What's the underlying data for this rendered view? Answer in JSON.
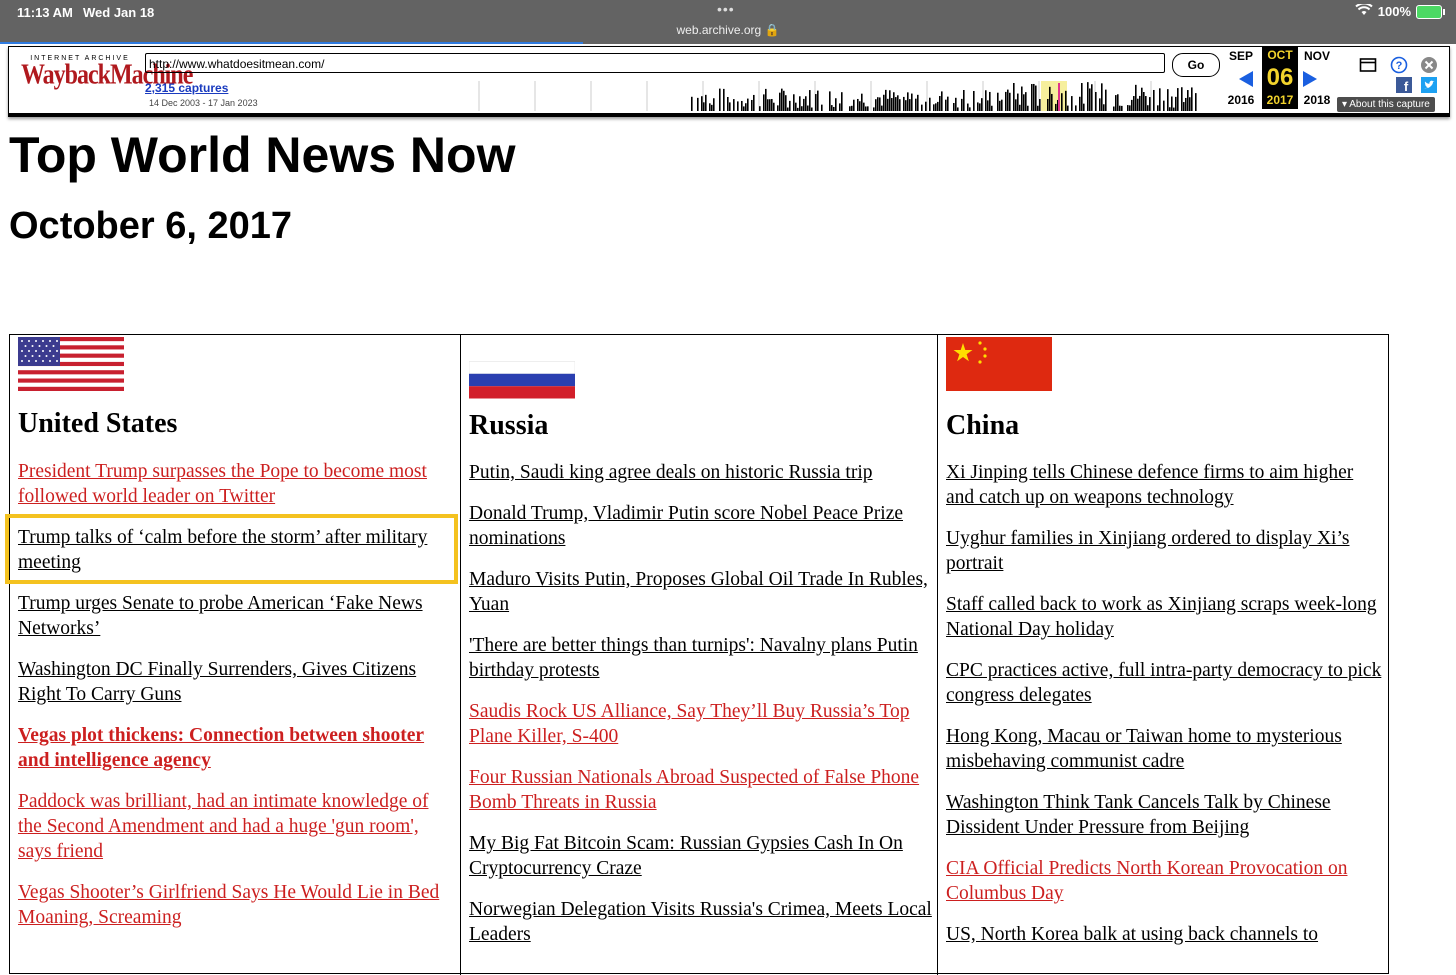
{
  "status_bar": {
    "time": "11:13 AM",
    "date": "Wed Jan 18",
    "url": "web.archive.org",
    "battery": "100%"
  },
  "wayback": {
    "logo_top": "INTERNET ARCHIVE",
    "logo_main": "WaybackMachine",
    "url_value": "http://www.whatdoesitmean.com/",
    "go_label": "Go",
    "captures": "2,315 captures",
    "range": "14 Dec 2003 - 17 Jan 2023",
    "prev_month": "SEP",
    "cur_month": "OCT",
    "next_month": "NOV",
    "cur_day": "06",
    "prev_year": "2016",
    "cur_year": "2017",
    "next_year": "2018",
    "about": "About this capture"
  },
  "page": {
    "title": "Top World News Now",
    "date": "October 6, 2017"
  },
  "columns": [
    {
      "country": "United States",
      "links": [
        {
          "text": "President Trump surpasses the Pope to become most followed world leader on Twitter",
          "style": "red"
        },
        {
          "text": "Trump talks of ‘calm before the storm’ after military meeting",
          "style": "black"
        },
        {
          "text": "Trump urges Senate to probe American ‘Fake News Networks’",
          "style": "black"
        },
        {
          "text": "Washington DC Finally Surrenders, Gives Citizens Right To Carry Guns",
          "style": "black"
        },
        {
          "text": "Vegas plot thickens: Connection between shooter and intelligence agency",
          "style": "red-bold"
        },
        {
          "text": "Paddock was brilliant, had an intimate knowledge of the Second Amendment and had a huge 'gun room', says friend",
          "style": "red"
        },
        {
          "text": "Vegas Shooter’s Girlfriend Says He Would Lie in Bed Moaning, Screaming",
          "style": "red"
        }
      ]
    },
    {
      "country": "Russia",
      "links": [
        {
          "text": "Putin, Saudi king agree deals on historic Russia trip",
          "style": "black"
        },
        {
          "text": "Donald Trump, Vladimir Putin score Nobel Peace Prize nominations",
          "style": "black"
        },
        {
          "text": "Maduro Visits Putin, Proposes Global Oil Trade In Rubles, Yuan",
          "style": "black"
        },
        {
          "text": "'There are better things than turnips': Navalny plans Putin birthday protests",
          "style": "black"
        },
        {
          "text": "Saudis Rock US Alliance, Say They’ll Buy Russia’s Top Plane Killer, S-400",
          "style": "red"
        },
        {
          "text": "Four Russian Nationals Abroad Suspected of False Phone Bomb Threats in Russia",
          "style": "red"
        },
        {
          "text": "My Big Fat Bitcoin Scam: Russian Gypsies Cash In On Cryptocurrency Craze",
          "style": "black"
        },
        {
          "text": "Norwegian Delegation Visits Russia's Crimea, Meets Local Leaders",
          "style": "black"
        }
      ]
    },
    {
      "country": "China",
      "links": [
        {
          "text": "Xi Jinping tells Chinese defence firms to aim higher and catch up on weapons technology",
          "style": "black"
        },
        {
          "text": "Uyghur families in Xinjiang ordered to display Xi’s portrait",
          "style": "black"
        },
        {
          "text": "Staff called back to work as Xinjiang scraps week-long National Day holiday",
          "style": "black"
        },
        {
          "text": "CPC practices active, full intra-party democracy to pick congress delegates",
          "style": "black"
        },
        {
          "text": "Hong Kong, Macau or Taiwan home to mysterious misbehaving communist cadre",
          "style": "black"
        },
        {
          "text": "Washington Think Tank Cancels Talk by Chinese Dissident Under Pressure from Beijing",
          "style": "black"
        },
        {
          "text": "CIA Official Predicts North Korean Provocation on Columbus Day",
          "style": "red"
        },
        {
          "text": "US, North Korea balk at using back channels to",
          "style": "black"
        }
      ]
    }
  ],
  "colors": {
    "link_red": "#cc1f1f",
    "highlight": "#f4c21f",
    "wayback_red": "#b0191e"
  }
}
